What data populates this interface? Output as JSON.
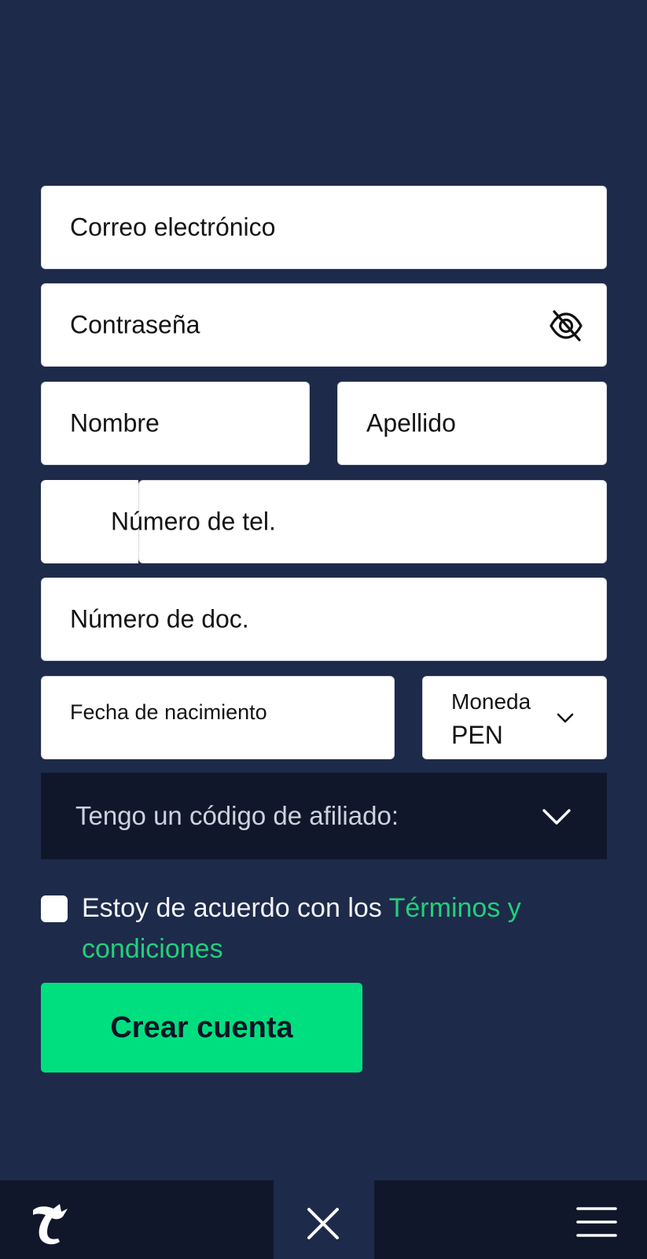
{
  "form": {
    "email_placeholder": "Correo electrónico",
    "password_placeholder": "Contraseña",
    "first_name_placeholder": "Nombre",
    "last_name_placeholder": "Apellido",
    "phone_placeholder": "Número de tel.",
    "document_placeholder": "Número de doc.",
    "birthdate_placeholder": "Fecha de nacimiento",
    "currency_label": "Moneda",
    "currency_value": "PEN"
  },
  "affiliate": {
    "label": "Tengo un código de afiliado:"
  },
  "terms": {
    "prefix": "Estoy de acuerdo con los ",
    "link": "Términos y condiciones",
    "checked": false
  },
  "cta": {
    "label": "Crear cuenta"
  },
  "bottom_bar": {
    "icons": [
      "logo-icon",
      "close-icon",
      "menu-icon"
    ]
  },
  "colors": {
    "background": "#1e2a4a",
    "dark_panel": "#11172b",
    "accent": "#00df80",
    "link": "#22d07a"
  }
}
